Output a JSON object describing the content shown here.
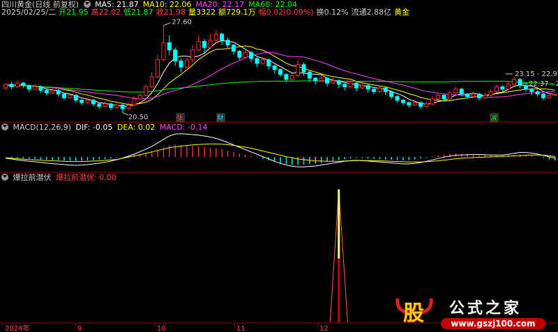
{
  "header": {
    "stock_title": "四川黄金(日线 前复权)",
    "ma_labels": [
      {
        "text": "MA5: 21.87",
        "color": "#ffffff"
      },
      {
        "text": "MA10: 22.06",
        "color": "#ffff00"
      },
      {
        "text": "MA20: 22.17",
        "color": "#ff40ff"
      },
      {
        "text": "MA60: 22.04",
        "color": "#00ff00"
      }
    ],
    "info_items": [
      {
        "text": "2025/02/25/二",
        "color": "#cccccc"
      },
      {
        "text": "开21.95",
        "color": "#00ff00"
      },
      {
        "text": "高22.02",
        "color": "#ff4040"
      },
      {
        "text": "低21.87",
        "color": "#00ff00"
      },
      {
        "text": "收21.98",
        "color": "#ff4040"
      },
      {
        "text": "量3322",
        "color": "#ffff00"
      },
      {
        "text": "额729.1万",
        "color": "#ffff00"
      },
      {
        "text": "幅0.02(0.09%)",
        "color": "#ff4040"
      },
      {
        "text": "换0.12%",
        "color": "#cccccc"
      },
      {
        "text": "流通2.88亿",
        "color": "#cccccc"
      },
      {
        "text": "黄金",
        "color": "#ffff00"
      }
    ]
  },
  "macd_header": {
    "title": "MACD(12,26,9)",
    "dif": "DIF: -0.05",
    "dea": "DEA: 0.02",
    "macd": "MACD: -0.14"
  },
  "indicator_header": {
    "title": "爆拉前潜伏",
    "value_label": "爆拉前潜伏: 0.00"
  },
  "annotations": {
    "high_label": "27.60",
    "low_label": "20.50",
    "right_high_label": "23.15 - 22.97",
    "right_mid_label": "22.37 - 22"
  },
  "markers": [
    "张",
    "财",
    "减"
  ],
  "x_axis_labels": [
    "2024年",
    "9",
    "10",
    "11",
    "12"
  ],
  "watermark": {
    "logo_char": "股",
    "brand": "公式之家",
    "url": "www.gszj100.com"
  },
  "colors": {
    "up": "#ff3030",
    "down": "#00ffff",
    "ma5": "#ffffff",
    "ma10": "#ffff00",
    "ma20": "#ff40ff",
    "ma60": "#00ff00",
    "axis": "#a00000",
    "spike_top": "#ffff80",
    "spike_bottom": "#cc0000"
  },
  "chart_data": [
    {
      "type": "candlestick",
      "price_range": [
        20.0,
        28.2
      ],
      "candles": [
        [
          22.5,
          22.8,
          22.9,
          22.3
        ],
        [
          22.8,
          22.6,
          23.0,
          22.4
        ],
        [
          22.6,
          22.9,
          23.1,
          22.5
        ],
        [
          22.9,
          22.7,
          23.0,
          22.5
        ],
        [
          22.7,
          22.4,
          22.8,
          22.2
        ],
        [
          22.4,
          22.6,
          22.8,
          22.3
        ],
        [
          22.6,
          22.3,
          22.7,
          22.1
        ],
        [
          22.3,
          22.1,
          22.4,
          21.9
        ],
        [
          22.1,
          22.3,
          22.5,
          22.0
        ],
        [
          22.3,
          22.0,
          22.4,
          21.8
        ],
        [
          22.0,
          21.7,
          22.1,
          21.5
        ],
        [
          21.7,
          21.9,
          22.0,
          21.6
        ],
        [
          21.9,
          21.5,
          22.0,
          21.3
        ],
        [
          21.5,
          21.3,
          21.6,
          21.1
        ],
        [
          21.3,
          21.5,
          21.7,
          21.2
        ],
        [
          21.5,
          21.2,
          21.6,
          21.0
        ],
        [
          21.2,
          21.0,
          21.3,
          20.8
        ],
        [
          21.0,
          21.2,
          21.4,
          20.9
        ],
        [
          21.2,
          20.9,
          21.3,
          20.7
        ],
        [
          20.9,
          21.1,
          21.2,
          20.8
        ],
        [
          21.1,
          20.8,
          21.2,
          20.5
        ],
        [
          20.8,
          21.1,
          21.3,
          20.7
        ],
        [
          21.1,
          21.6,
          21.8,
          21.0
        ],
        [
          21.6,
          21.9,
          22.1,
          21.5
        ],
        [
          21.9,
          22.6,
          22.8,
          21.8
        ],
        [
          22.6,
          23.4,
          23.8,
          22.5
        ],
        [
          23.4,
          24.8,
          25.2,
          23.3
        ],
        [
          24.8,
          26.2,
          27.6,
          24.7
        ],
        [
          26.2,
          25.6,
          26.8,
          25.2
        ],
        [
          25.6,
          24.7,
          25.8,
          24.3
        ],
        [
          24.7,
          24.2,
          24.9,
          23.8
        ],
        [
          24.2,
          24.8,
          25.0,
          24.0
        ],
        [
          24.8,
          25.6,
          26.0,
          24.6
        ],
        [
          25.6,
          26.3,
          26.8,
          25.5
        ],
        [
          26.3,
          25.8,
          26.5,
          25.4
        ],
        [
          25.8,
          26.4,
          26.9,
          25.7
        ],
        [
          26.4,
          26.9,
          27.2,
          26.2
        ],
        [
          26.9,
          26.4,
          27.0,
          26.0
        ],
        [
          26.4,
          26.0,
          26.6,
          25.7
        ],
        [
          26.0,
          25.5,
          26.1,
          25.2
        ],
        [
          25.5,
          25.0,
          25.6,
          24.8
        ],
        [
          25.0,
          25.4,
          25.6,
          24.9
        ],
        [
          25.4,
          24.9,
          25.5,
          24.6
        ],
        [
          24.9,
          24.5,
          25.0,
          24.2
        ],
        [
          24.5,
          24.8,
          25.0,
          24.4
        ],
        [
          24.8,
          24.3,
          24.9,
          24.0
        ],
        [
          24.3,
          24.0,
          24.4,
          23.7
        ],
        [
          24.0,
          23.6,
          24.1,
          23.4
        ],
        [
          23.6,
          23.2,
          23.7,
          23.0
        ],
        [
          23.2,
          23.5,
          23.7,
          23.1
        ],
        [
          23.5,
          24.4,
          24.8,
          23.4
        ],
        [
          24.4,
          23.8,
          24.6,
          23.5
        ],
        [
          23.8,
          23.3,
          23.9,
          23.0
        ],
        [
          23.3,
          23.1,
          23.4,
          22.8
        ],
        [
          23.1,
          23.3,
          23.5,
          23.0
        ],
        [
          23.3,
          22.9,
          23.4,
          22.6
        ],
        [
          22.9,
          23.1,
          23.3,
          22.8
        ],
        [
          23.1,
          22.8,
          23.2,
          22.5
        ],
        [
          22.8,
          22.6,
          22.9,
          22.3
        ],
        [
          22.6,
          22.9,
          23.1,
          22.5
        ],
        [
          22.9,
          22.5,
          23.0,
          22.2
        ],
        [
          22.5,
          22.7,
          22.9,
          22.4
        ],
        [
          22.7,
          22.4,
          22.8,
          22.1
        ],
        [
          22.4,
          22.2,
          22.5,
          22.0
        ],
        [
          22.2,
          22.5,
          22.7,
          22.1
        ],
        [
          22.5,
          22.2,
          22.6,
          21.9
        ],
        [
          22.2,
          21.8,
          22.3,
          21.6
        ],
        [
          21.8,
          21.5,
          21.9,
          21.3
        ],
        [
          21.5,
          21.3,
          21.6,
          21.1
        ],
        [
          21.3,
          21.1,
          21.4,
          20.9
        ],
        [
          21.1,
          21.3,
          21.5,
          21.0
        ],
        [
          21.3,
          21.0,
          21.4,
          20.8
        ],
        [
          21.0,
          21.2,
          21.4,
          20.9
        ],
        [
          21.2,
          21.6,
          21.8,
          21.1
        ],
        [
          21.6,
          21.9,
          22.1,
          21.5
        ],
        [
          21.9,
          21.6,
          22.0,
          21.4
        ],
        [
          21.6,
          22.1,
          22.3,
          21.5
        ],
        [
          22.1,
          22.4,
          22.6,
          22.0
        ],
        [
          22.4,
          22.0,
          22.5,
          21.8
        ],
        [
          22.0,
          21.8,
          22.1,
          21.6
        ],
        [
          21.8,
          22.0,
          22.2,
          21.7
        ],
        [
          22.0,
          21.7,
          22.1,
          21.5
        ],
        [
          21.7,
          21.9,
          22.1,
          21.6
        ],
        [
          21.9,
          22.2,
          22.4,
          21.8
        ],
        [
          22.2,
          22.6,
          22.8,
          22.1
        ],
        [
          22.6,
          22.4,
          22.7,
          22.2
        ],
        [
          22.4,
          22.8,
          23.0,
          22.3
        ],
        [
          22.8,
          23.2,
          23.4,
          22.7
        ],
        [
          23.2,
          22.7,
          23.3,
          22.5
        ],
        [
          22.7,
          22.4,
          22.8,
          22.2
        ],
        [
          22.4,
          22.2,
          22.5,
          21.9
        ],
        [
          22.2,
          22.0,
          22.3,
          21.8
        ],
        [
          22.0,
          21.7,
          22.1,
          21.5
        ],
        [
          21.7,
          21.9,
          22.1,
          21.6
        ],
        [
          21.9,
          21.98,
          22.02,
          21.87
        ]
      ],
      "ma_periods": [
        5,
        10,
        20,
        60
      ]
    },
    {
      "type": "bar",
      "name": "MACD",
      "values": [
        -0.02,
        -0.03,
        -0.05,
        -0.06,
        -0.07,
        -0.08,
        -0.1,
        -0.11,
        -0.12,
        -0.13,
        -0.14,
        -0.15,
        -0.16,
        -0.15,
        -0.14,
        -0.12,
        -0.1,
        -0.08,
        -0.05,
        -0.02,
        0.01,
        0.04,
        0.08,
        0.13,
        0.18,
        0.24,
        0.32,
        0.42,
        0.5,
        0.54,
        0.52,
        0.48,
        0.46,
        0.44,
        0.42,
        0.4,
        0.38,
        0.34,
        0.28,
        0.22,
        0.16,
        0.1,
        0.04,
        -0.02,
        -0.08,
        -0.14,
        -0.2,
        -0.26,
        -0.3,
        -0.33,
        -0.34,
        -0.32,
        -0.3,
        -0.27,
        -0.24,
        -0.2,
        -0.16,
        -0.12,
        -0.08,
        -0.05,
        -0.03,
        -0.04,
        -0.06,
        -0.07,
        -0.09,
        -0.1,
        -0.11,
        -0.12,
        -0.13,
        -0.12,
        -0.1,
        -0.06,
        -0.02,
        0.03,
        0.08,
        0.12,
        0.14,
        0.16,
        0.15,
        0.14,
        0.13,
        0.12,
        0.1,
        0.08,
        0.07,
        0.06,
        0.08,
        0.1,
        0.12,
        0.1,
        0.06,
        0.02,
        -0.04,
        -0.1,
        -0.14
      ]
    },
    {
      "type": "line",
      "name": "DIF/DEA",
      "series": [
        {
          "name": "DIF",
          "values": [
            -0.05,
            -0.08,
            -0.12,
            -0.15,
            -0.18,
            -0.2,
            -0.23,
            -0.26,
            -0.28,
            -0.3,
            -0.32,
            -0.34,
            -0.35,
            -0.34,
            -0.32,
            -0.29,
            -0.26,
            -0.22,
            -0.17,
            -0.11,
            -0.04,
            0.04,
            0.13,
            0.23,
            0.34,
            0.46,
            0.6,
            0.76,
            0.9,
            0.98,
            1.0,
            0.98,
            0.96,
            0.94,
            0.9,
            0.86,
            0.8,
            0.72,
            0.62,
            0.52,
            0.42,
            0.32,
            0.22,
            0.12,
            0.02,
            -0.08,
            -0.18,
            -0.27,
            -0.34,
            -0.39,
            -0.42,
            -0.42,
            -0.4,
            -0.38,
            -0.34,
            -0.3,
            -0.26,
            -0.22,
            -0.18,
            -0.15,
            -0.14,
            -0.15,
            -0.17,
            -0.19,
            -0.21,
            -0.23,
            -0.25,
            -0.27,
            -0.29,
            -0.29,
            -0.27,
            -0.23,
            -0.18,
            -0.12,
            -0.06,
            0.0,
            0.04,
            0.08,
            0.09,
            0.1,
            0.11,
            0.11,
            0.1,
            0.09,
            0.09,
            0.09,
            0.12,
            0.16,
            0.2,
            0.2,
            0.17,
            0.13,
            0.07,
            0.01,
            -0.05
          ]
        },
        {
          "name": "DEA",
          "values": [
            -0.03,
            -0.05,
            -0.07,
            -0.09,
            -0.11,
            -0.12,
            -0.13,
            -0.15,
            -0.16,
            -0.17,
            -0.18,
            -0.19,
            -0.19,
            -0.19,
            -0.18,
            -0.17,
            -0.16,
            -0.14,
            -0.12,
            -0.1,
            -0.05,
            0.0,
            0.05,
            0.1,
            0.16,
            0.22,
            0.28,
            0.34,
            0.4,
            0.44,
            0.47,
            0.5,
            0.52,
            0.54,
            0.55,
            0.56,
            0.56,
            0.55,
            0.53,
            0.5,
            0.46,
            0.42,
            0.38,
            0.32,
            0.26,
            0.2,
            0.14,
            0.08,
            0.02,
            -0.03,
            -0.08,
            -0.11,
            -0.14,
            -0.16,
            -0.17,
            -0.18,
            -0.18,
            -0.18,
            -0.17,
            -0.16,
            -0.15,
            -0.15,
            -0.15,
            -0.15,
            -0.16,
            -0.17,
            -0.18,
            -0.19,
            -0.2,
            -0.21,
            -0.21,
            -0.21,
            -0.2,
            -0.18,
            -0.16,
            -0.13,
            -0.1,
            -0.07,
            -0.05,
            -0.03,
            -0.02,
            -0.01,
            0.0,
            0.01,
            0.02,
            0.03,
            0.04,
            0.05,
            0.06,
            0.08,
            0.09,
            0.09,
            0.08,
            0.06,
            0.02
          ]
        }
      ]
    },
    {
      "type": "line",
      "name": "爆拉前潜伏",
      "spike_index": 57,
      "spike_value": 1.0,
      "value_range": [
        0,
        1.05
      ]
    }
  ]
}
